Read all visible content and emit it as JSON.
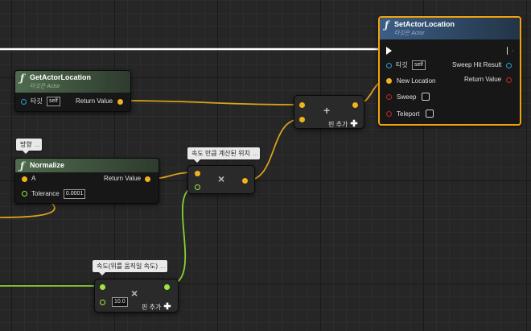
{
  "nodes": {
    "get_actor_location": {
      "title": "GetActorLocation",
      "subtitle": "타깃은 Actor",
      "target_label": "타깃",
      "target_value": "self",
      "return_label": "Return Value"
    },
    "normalize": {
      "title": "Normalize",
      "a_label": "A",
      "return_label": "Return Value",
      "tolerance_label": "Tolerance",
      "tolerance_value": "0.0001"
    },
    "set_actor_location": {
      "title": "SetActorLocation",
      "subtitle": "타깃은 Actor",
      "target_label": "타깃",
      "target_value": "self",
      "sweep_hit_result_label": "Sweep Hit Result",
      "return_label": "Return Value",
      "new_location_label": "New Location",
      "sweep_label": "Sweep",
      "teleport_label": "Teleport"
    },
    "add_node": {
      "symbol": "+",
      "add_pin_label": "핀 추가"
    },
    "multiply_vector": {
      "symbol": "×"
    },
    "multiply_float": {
      "symbol": "×",
      "value": "10.0",
      "add_pin_label": "핀 추가"
    }
  },
  "comments": {
    "direction": "방향",
    "speed_calc_position": "속도 만큼 계산된 위치",
    "speed": "속도(위를 움직일 속도)"
  },
  "icons": {
    "function": "ƒ",
    "plus": "✚",
    "dots": "⋯"
  },
  "colors": {
    "vector_pin": "#f2b21c",
    "float_pin": "#9be83d",
    "object_pin": "#2f7fe0",
    "bool_pin": "#c0262a",
    "exec_pin": "#ffffff",
    "selection": "#f3a20b"
  }
}
